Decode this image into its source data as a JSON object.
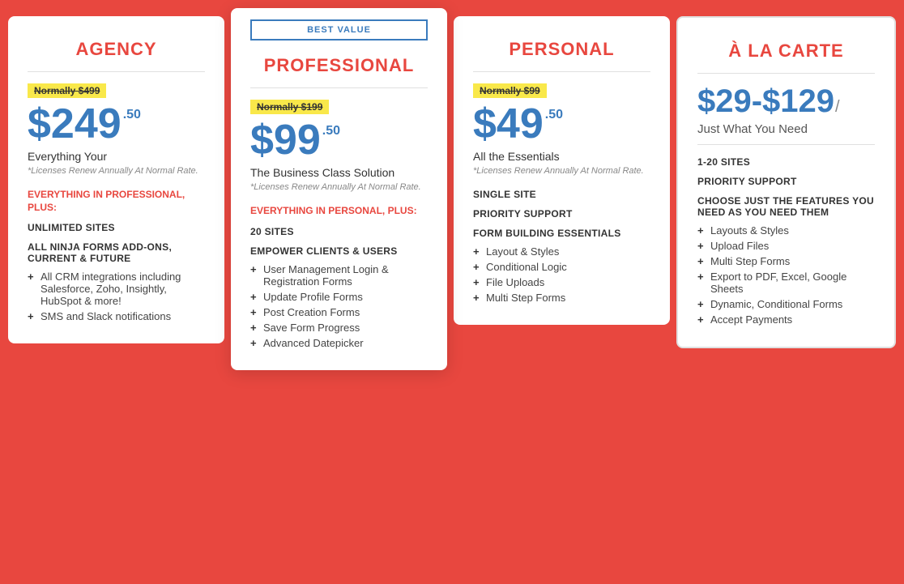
{
  "plans": [
    {
      "id": "agency",
      "title": "AGENCY",
      "featured": false,
      "bestValue": false,
      "normally": "Normally $499",
      "price": "$249",
      "priceSup": ".50",
      "tagline": "Everything Your",
      "note": "*Licenses Renew Annually At Normal Rate.",
      "sectionLabel": "EVERYTHING IN PROFESSIONAL, PLUS:",
      "features_heading": "",
      "bold_features": [
        "UNLIMITED SITES",
        "ALL NINJA FORMS ADD-ONS, CURRENT & FUTURE"
      ],
      "features": [
        "All CRM integrations including Salesforce, Zoho, Insightly, HubSpot & more!",
        "SMS and Slack notifications"
      ]
    },
    {
      "id": "professional",
      "title": "PROFESSIONAL",
      "featured": true,
      "bestValue": true,
      "normally": "Normally $199",
      "price": "$99",
      "priceSup": ".50",
      "tagline": "The Business Class Solution",
      "note": "*Licenses Renew Annually At Normal Rate.",
      "sectionLabel": "EVERYTHING IN PERSONAL, PLUS:",
      "bold_features": [
        "20 SITES",
        "EMPOWER CLIENTS & USERS"
      ],
      "features": [
        "User Management Login & Registration Forms",
        "Update Profile Forms",
        "Post Creation Forms",
        "Save Form Progress",
        "Advanced Datepicker"
      ]
    },
    {
      "id": "personal",
      "title": "PERSONAL",
      "featured": false,
      "bestValue": false,
      "normally": "Normally $99",
      "price": "$49",
      "priceSup": ".50",
      "tagline": "All the Essentials",
      "note": "*Licenses Renew Annually At Normal Rate.",
      "bold_features": [
        "SINGLE SITE",
        "PRIORITY SUPPORT",
        "FORM BUILDING ESSENTIALS"
      ],
      "features": [
        "Layout & Styles",
        "Conditional Logic",
        "File Uploads",
        "Multi Step Forms"
      ]
    },
    {
      "id": "alacarte",
      "title": "À LA CARTE",
      "featured": false,
      "bestValue": false,
      "priceRange": "$29-$129",
      "priceSubtitle": "Just What You Need",
      "bold_features": [
        "1-20 SITES",
        "PRIORITY SUPPORT",
        "CHOOSE JUST THE FEATURES YOU NEED AS YOU NEED THEM"
      ],
      "features": [
        "Layouts & Styles",
        "Upload Files",
        "Multi Step Forms",
        "Export to PDF, Excel, Google Sheets",
        "Dynamic, Conditional Forms",
        "Accept Payments"
      ]
    }
  ],
  "badge": "BEST VALUE"
}
